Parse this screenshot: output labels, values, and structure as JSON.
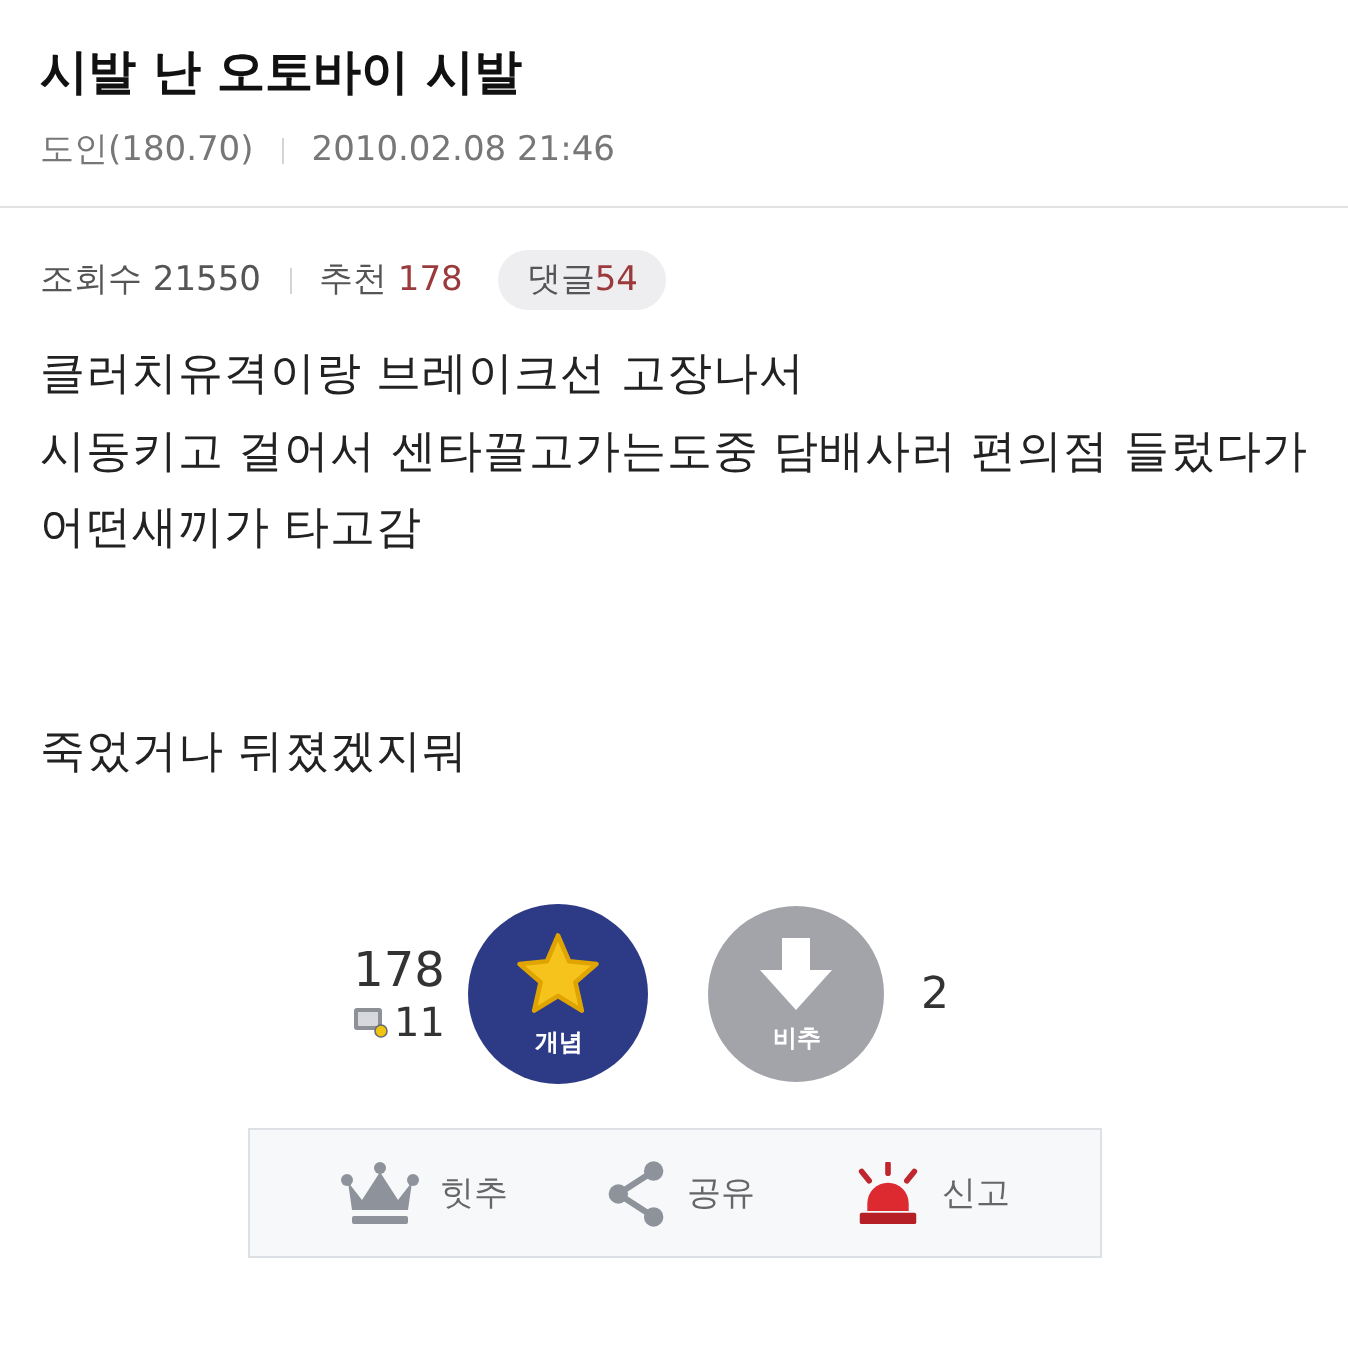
{
  "post": {
    "title": "시발 난 오토바이 시발",
    "author": "도인(180.70)",
    "date": "2010.02.08 21:46"
  },
  "stats": [
    {
      "kind": "plain",
      "label": "조회수",
      "value": "21550",
      "highlight": false
    },
    {
      "kind": "plain",
      "label": "추천",
      "value": "178",
      "highlight": true
    },
    {
      "kind": "pill",
      "label": "댓글",
      "value": "54",
      "highlight": true
    }
  ],
  "body": [
    {
      "lines": [
        "클러치유격이랑 브레이크선 고장나서",
        "시동키고 걸어서 센타끌고가는도중 담배사러 편의점 들렀다가",
        "어떤새끼가 타고감"
      ]
    },
    {
      "lines": [
        "죽었거나 뒤졌겠지뭐"
      ]
    }
  ],
  "vote": {
    "up_count": "178",
    "fixed_count": "11",
    "up_label": "개념",
    "down_label": "비추",
    "down_count": "2"
  },
  "actions": [
    {
      "kind": "crown",
      "label": "힛추"
    },
    {
      "kind": "share",
      "label": "공유"
    },
    {
      "kind": "siren",
      "label": "신고"
    }
  ]
}
